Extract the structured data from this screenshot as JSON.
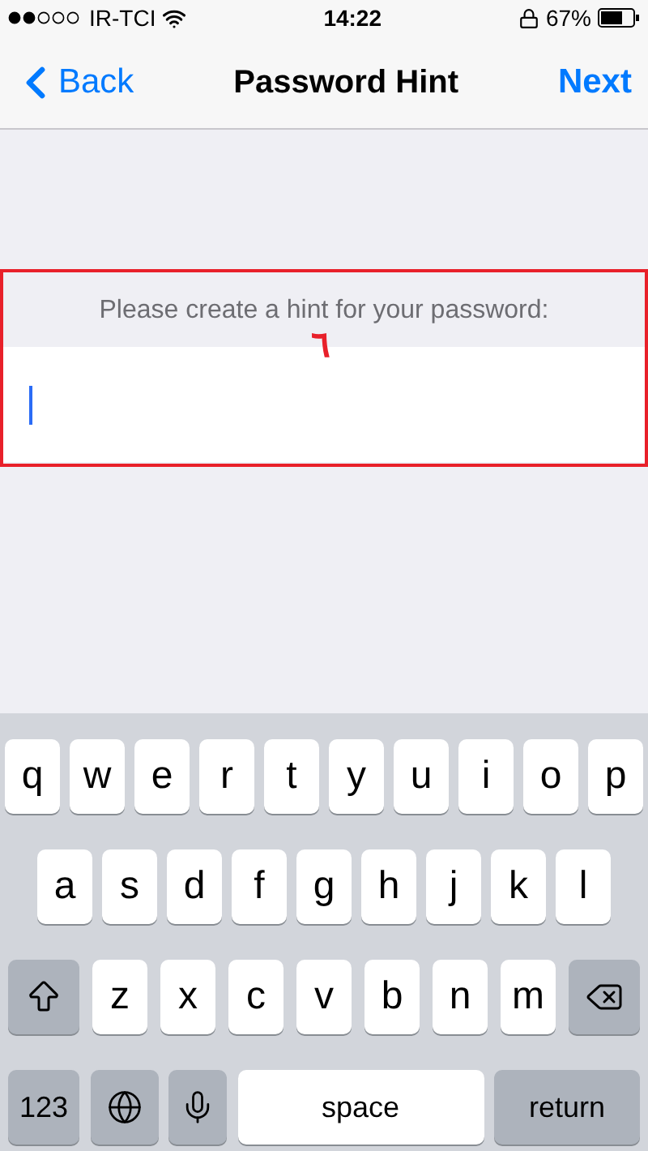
{
  "status_bar": {
    "carrier": "IR-TCI",
    "time": "14:22",
    "battery": "67%"
  },
  "nav": {
    "back": "Back",
    "title": "Password Hint",
    "next": "Next"
  },
  "hint": {
    "prompt": "Please create a hint for your password:",
    "annotation": "٦"
  },
  "keyboard": {
    "rows": [
      {
        "keys": [
          {
            "kind": "letter",
            "label": "q"
          },
          {
            "kind": "letter",
            "label": "w"
          },
          {
            "kind": "letter",
            "label": "e"
          },
          {
            "kind": "letter",
            "label": "r"
          },
          {
            "kind": "letter",
            "label": "t"
          },
          {
            "kind": "letter",
            "label": "y"
          },
          {
            "kind": "letter",
            "label": "u"
          },
          {
            "kind": "letter",
            "label": "i"
          },
          {
            "kind": "letter",
            "label": "o"
          },
          {
            "kind": "letter",
            "label": "p"
          }
        ]
      },
      {
        "keys": [
          {
            "kind": "letter",
            "label": "a"
          },
          {
            "kind": "letter",
            "label": "s"
          },
          {
            "kind": "letter",
            "label": "d"
          },
          {
            "kind": "letter",
            "label": "f"
          },
          {
            "kind": "letter",
            "label": "g"
          },
          {
            "kind": "letter",
            "label": "h"
          },
          {
            "kind": "letter",
            "label": "j"
          },
          {
            "kind": "letter",
            "label": "k"
          },
          {
            "kind": "letter",
            "label": "l"
          }
        ]
      },
      {
        "keys": [
          {
            "kind": "shift"
          },
          {
            "kind": "letter",
            "label": "z"
          },
          {
            "kind": "letter",
            "label": "x"
          },
          {
            "kind": "letter",
            "label": "c"
          },
          {
            "kind": "letter",
            "label": "v"
          },
          {
            "kind": "letter",
            "label": "b"
          },
          {
            "kind": "letter",
            "label": "n"
          },
          {
            "kind": "letter",
            "label": "m"
          },
          {
            "kind": "delete"
          }
        ]
      },
      {
        "keys": [
          {
            "kind": "mode",
            "label": "123"
          },
          {
            "kind": "globe"
          },
          {
            "kind": "mic"
          },
          {
            "kind": "space",
            "label": "space"
          },
          {
            "kind": "return",
            "label": "return"
          }
        ]
      }
    ]
  }
}
